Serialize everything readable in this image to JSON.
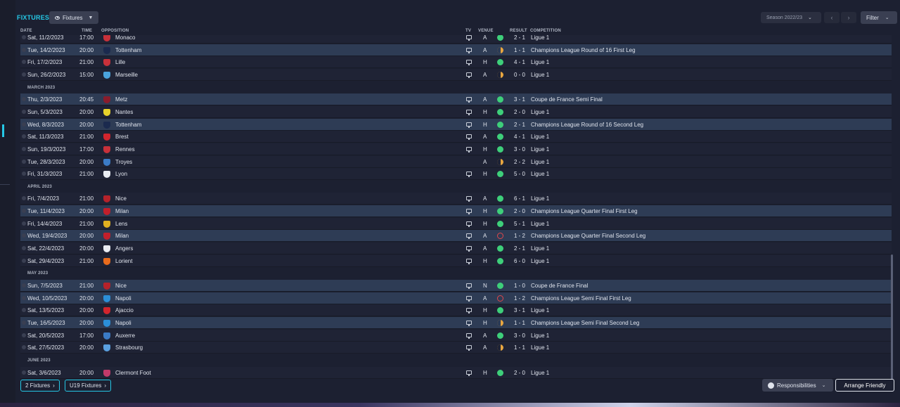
{
  "header": {
    "title": "FIXTURES",
    "view_dropdown": "Fixtures",
    "season": "Season 2022/23",
    "filter": "Filter"
  },
  "columns": {
    "date": "DATE",
    "time": "TIME",
    "opposition": "OPPOSITION",
    "tv": "TV",
    "venue": "VENUE",
    "result": "RESULT",
    "competition": "COMPETITION"
  },
  "colors": {
    "accent": "#25c8e6",
    "win": "#3ecf7a",
    "draw": "#e8a640",
    "loss": "#e0474c",
    "highlight_row": "#2e3c55"
  },
  "rows": [
    {
      "type": "match",
      "date": "Sat, 11/2/2023",
      "time": "17:00",
      "opp": "Monaco",
      "crest": "#c8313a",
      "tv": true,
      "venue": "A",
      "outcome": "win",
      "result": "2 - 1",
      "comp": "Ligue 1",
      "hl": false
    },
    {
      "type": "match",
      "date": "Tue, 14/2/2023",
      "time": "20:00",
      "opp": "Tottenham",
      "crest": "#1b2a4e",
      "tv": true,
      "venue": "A",
      "outcome": "draw",
      "result": "1 - 1",
      "comp": "Champions League Round of 16  First Leg",
      "hl": true
    },
    {
      "type": "match",
      "date": "Fri, 17/2/2023",
      "time": "21:00",
      "opp": "Lille",
      "crest": "#c8313a",
      "tv": true,
      "venue": "H",
      "outcome": "win",
      "result": "4 - 1",
      "comp": "Ligue 1",
      "hl": false
    },
    {
      "type": "match",
      "date": "Sun, 26/2/2023",
      "time": "15:00",
      "opp": "Marseille",
      "crest": "#4aa3dd",
      "tv": true,
      "venue": "A",
      "outcome": "draw",
      "result": "0 - 0",
      "comp": "Ligue 1",
      "hl": false
    },
    {
      "type": "month",
      "label": "MARCH 2023"
    },
    {
      "type": "match",
      "date": "Thu, 2/3/2023",
      "time": "20:45",
      "opp": "Metz",
      "crest": "#8a1c2c",
      "tv": true,
      "venue": "A",
      "outcome": "win",
      "result": "3 - 1",
      "comp": "Coupe de France Semi Final",
      "hl": true
    },
    {
      "type": "match",
      "date": "Sun, 5/3/2023",
      "time": "20:00",
      "opp": "Nantes",
      "crest": "#e8d22a",
      "tv": true,
      "venue": "H",
      "outcome": "win",
      "result": "2 - 0",
      "comp": "Ligue 1",
      "hl": false
    },
    {
      "type": "match",
      "date": "Wed, 8/3/2023",
      "time": "20:00",
      "opp": "Tottenham",
      "crest": "#1b2a4e",
      "tv": true,
      "venue": "H",
      "outcome": "win",
      "result": "2 - 1",
      "comp": "Champions League Round of 16  Second Leg",
      "hl": true
    },
    {
      "type": "match",
      "date": "Sat, 11/3/2023",
      "time": "21:00",
      "opp": "Brest",
      "crest": "#d2252d",
      "tv": true,
      "venue": "A",
      "outcome": "win",
      "result": "4 - 1",
      "comp": "Ligue 1",
      "hl": false
    },
    {
      "type": "match",
      "date": "Sun, 19/3/2023",
      "time": "17:00",
      "opp": "Rennes",
      "crest": "#c8313a",
      "tv": true,
      "venue": "H",
      "outcome": "win",
      "result": "3 - 0",
      "comp": "Ligue 1",
      "hl": false
    },
    {
      "type": "match",
      "date": "Tue, 28/3/2023",
      "time": "20:00",
      "opp": "Troyes",
      "crest": "#3b7bc6",
      "tv": false,
      "venue": "A",
      "outcome": "draw",
      "result": "2 - 2",
      "comp": "Ligue 1",
      "hl": false
    },
    {
      "type": "match",
      "date": "Fri, 31/3/2023",
      "time": "21:00",
      "opp": "Lyon",
      "crest": "#e9ecf2",
      "tv": true,
      "venue": "H",
      "outcome": "win",
      "result": "5 - 0",
      "comp": "Ligue 1",
      "hl": false
    },
    {
      "type": "month",
      "label": "APRIL 2023"
    },
    {
      "type": "match",
      "date": "Fri, 7/4/2023",
      "time": "21:00",
      "opp": "Nice",
      "crest": "#b5222a",
      "tv": true,
      "venue": "A",
      "outcome": "win",
      "result": "6 - 1",
      "comp": "Ligue 1",
      "hl": false
    },
    {
      "type": "match",
      "date": "Tue, 11/4/2023",
      "time": "20:00",
      "opp": "Milan",
      "crest": "#c21f2b",
      "tv": true,
      "venue": "H",
      "outcome": "win",
      "result": "2 - 0",
      "comp": "Champions League Quarter Final First Leg",
      "hl": true
    },
    {
      "type": "match",
      "date": "Fri, 14/4/2023",
      "time": "21:00",
      "opp": "Lens",
      "crest": "#e0b020",
      "tv": true,
      "venue": "H",
      "outcome": "win",
      "result": "5 - 1",
      "comp": "Ligue 1",
      "hl": false
    },
    {
      "type": "match",
      "date": "Wed, 19/4/2023",
      "time": "20:00",
      "opp": "Milan",
      "crest": "#c21f2b",
      "tv": true,
      "venue": "A",
      "outcome": "loss",
      "result": "1 - 2",
      "comp": "Champions League Quarter Final Second Leg",
      "hl": true
    },
    {
      "type": "match",
      "date": "Sat, 22/4/2023",
      "time": "20:00",
      "opp": "Angers",
      "crest": "#e9ecf2",
      "tv": true,
      "venue": "A",
      "outcome": "win",
      "result": "2 - 1",
      "comp": "Ligue 1",
      "hl": false
    },
    {
      "type": "match",
      "date": "Sat, 29/4/2023",
      "time": "21:00",
      "opp": "Lorient",
      "crest": "#e86b1c",
      "tv": true,
      "venue": "H",
      "outcome": "win",
      "result": "6 - 0",
      "comp": "Ligue 1",
      "hl": false
    },
    {
      "type": "month",
      "label": "MAY 2023"
    },
    {
      "type": "match",
      "date": "Sun, 7/5/2023",
      "time": "21:00",
      "opp": "Nice",
      "crest": "#b5222a",
      "tv": true,
      "venue": "N",
      "outcome": "win",
      "result": "1 - 0",
      "comp": "Coupe de France Final",
      "hl": true
    },
    {
      "type": "match",
      "date": "Wed, 10/5/2023",
      "time": "20:00",
      "opp": "Napoli",
      "crest": "#2b8fd8",
      "tv": true,
      "venue": "A",
      "outcome": "loss",
      "result": "1 - 2",
      "comp": "Champions League Semi Final First Leg",
      "hl": true
    },
    {
      "type": "match",
      "date": "Sat, 13/5/2023",
      "time": "20:00",
      "opp": "Ajaccio",
      "crest": "#d2252d",
      "tv": true,
      "venue": "H",
      "outcome": "win",
      "result": "3 - 1",
      "comp": "Ligue 1",
      "hl": false
    },
    {
      "type": "match",
      "date": "Tue, 16/5/2023",
      "time": "20:00",
      "opp": "Napoli",
      "crest": "#2b8fd8",
      "tv": true,
      "venue": "H",
      "outcome": "draw",
      "result": "1 - 1",
      "comp": "Champions League Semi Final Second Leg",
      "hl": true
    },
    {
      "type": "match",
      "date": "Sat, 20/5/2023",
      "time": "17:00",
      "opp": "Auxerre",
      "crest": "#3b7bc6",
      "tv": true,
      "venue": "A",
      "outcome": "win",
      "result": "3 - 0",
      "comp": "Ligue 1",
      "hl": false
    },
    {
      "type": "match",
      "date": "Sat, 27/5/2023",
      "time": "20:00",
      "opp": "Strasbourg",
      "crest": "#5aa0e0",
      "tv": true,
      "venue": "A",
      "outcome": "draw",
      "result": "1 - 1",
      "comp": "Ligue 1",
      "hl": false
    },
    {
      "type": "month",
      "label": "JUNE 2023"
    },
    {
      "type": "match",
      "date": "Sat, 3/6/2023",
      "time": "20:00",
      "opp": "Clermont Foot",
      "crest": "#c23a6a",
      "tv": true,
      "venue": "H",
      "outcome": "win",
      "result": "2 - 0",
      "comp": "Ligue 1",
      "hl": false
    }
  ],
  "footer": {
    "fixtures_link": "2 Fixtures",
    "u19_link": "U19 Fixtures",
    "responsibilities": "Responsibilities",
    "arrange_friendly": "Arrange Friendly"
  }
}
